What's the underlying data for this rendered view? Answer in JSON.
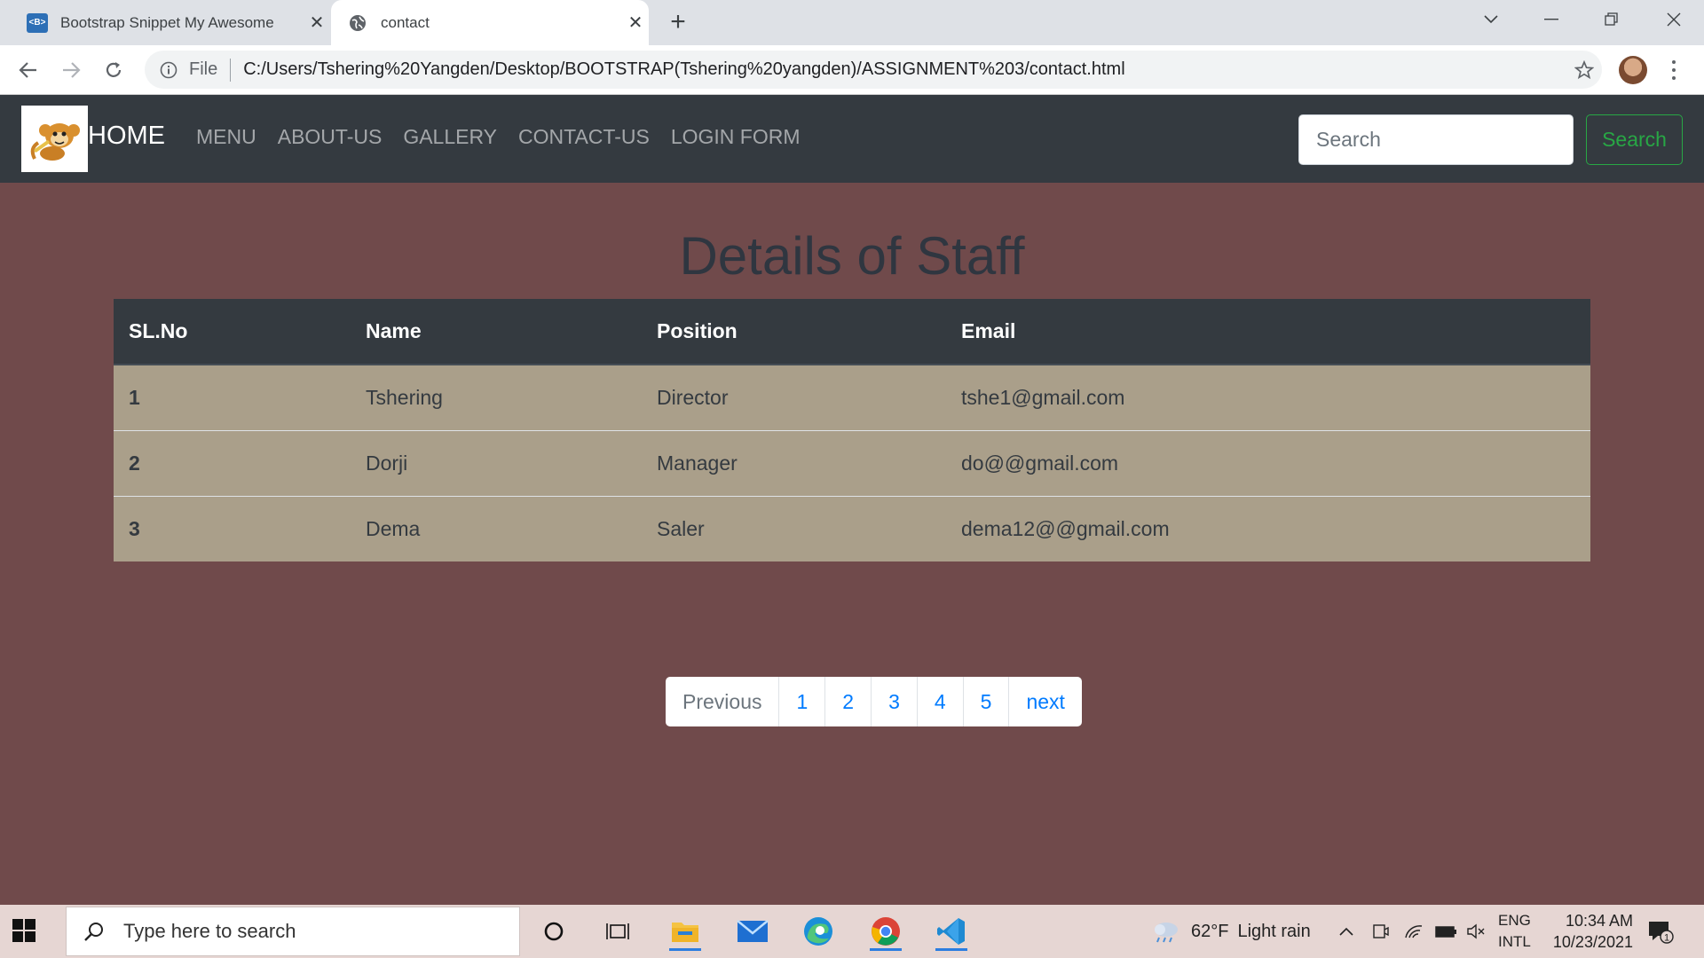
{
  "browser": {
    "tabs": [
      {
        "title": "Bootstrap Snippet My Awesome",
        "favicon": "bootstrap-icon",
        "active": false
      },
      {
        "title": "contact",
        "favicon": "globe-icon",
        "active": true
      }
    ],
    "address": {
      "scheme_label": "File",
      "url": "C:/Users/Tshering%20Yangden/Desktop/BOOTSTRAP(Tshering%20yangden)/ASSIGNMENT%203/contact.html"
    }
  },
  "navbar": {
    "brand": "HOME",
    "links": [
      "MENU",
      "ABOUT-US",
      "GALLERY",
      "CONTACT-US",
      "LOGIN FORM"
    ],
    "search_placeholder": "Search",
    "search_button": "Search"
  },
  "page": {
    "title": "Details of Staff",
    "table": {
      "headers": [
        "SL.No",
        "Name",
        "Position",
        "Email"
      ],
      "rows": [
        [
          "1",
          "Tshering",
          "Director",
          "tshe1@gmail.com"
        ],
        [
          "2",
          "Dorji",
          "Manager",
          "do@@gmail.com"
        ],
        [
          "3",
          "Dema",
          "Saler",
          "dema12@@gmail.com"
        ]
      ]
    },
    "pagination": [
      "Previous",
      "1",
      "2",
      "3",
      "4",
      "5",
      "next"
    ]
  },
  "taskbar": {
    "search_placeholder": "Type here to search",
    "weather": {
      "temp": "62°F",
      "condition": "Light rain"
    },
    "language": {
      "line1": "ENG",
      "line2": "INTL"
    },
    "time": "10:34 AM",
    "date": "10/23/2021",
    "notification_count": "1"
  },
  "colors": {
    "page_bg": "#704a4b",
    "navbar_bg": "#343a40",
    "row_bg": "#aa9f8a",
    "accent_green": "#28a745",
    "link_blue": "#007bff"
  }
}
